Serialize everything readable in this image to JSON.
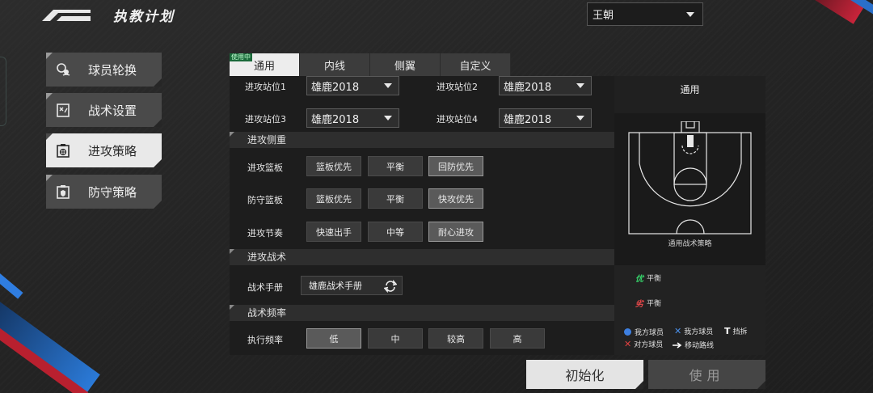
{
  "header": {
    "title": "执教计划",
    "player_select": "王朝"
  },
  "menu": {
    "items": [
      {
        "label": "球员轮换",
        "icon": "player-swap-icon"
      },
      {
        "label": "战术设置",
        "icon": "tactics-board-icon"
      },
      {
        "label": "进攻策略",
        "icon": "offense-strategy-icon",
        "active": true
      },
      {
        "label": "防守策略",
        "icon": "defense-strategy-icon"
      }
    ]
  },
  "tabs": {
    "in_use_badge": "使用中",
    "items": [
      "通用",
      "内线",
      "侧翼",
      "自定义"
    ],
    "active": "通用"
  },
  "positions": {
    "pos1_label": "进攻站位1",
    "pos1_value": "雄鹿2018",
    "pos2_label": "进攻站位2",
    "pos2_value": "雄鹿2018",
    "pos3_label": "进攻站位3",
    "pos3_value": "雄鹿2018",
    "pos4_label": "进攻站位4",
    "pos4_value": "雄鹿2018"
  },
  "offense_focus": {
    "section_title": "进攻侧重",
    "rows": [
      {
        "label": "进攻篮板",
        "options": [
          "篮板优先",
          "平衡",
          "回防优先"
        ],
        "selected": "回防优先"
      },
      {
        "label": "防守篮板",
        "options": [
          "篮板优先",
          "平衡",
          "快攻优先"
        ],
        "selected": "快攻优先"
      },
      {
        "label": "进攻节奏",
        "options": [
          "快速出手",
          "中等",
          "耐心进攻"
        ],
        "selected": "耐心进攻"
      }
    ]
  },
  "offense_tactics": {
    "section_title": "进攻战术",
    "manual_label": "战术手册",
    "manual_value": "雄鹿战术手册"
  },
  "tactic_frequency": {
    "section_title": "战术频率",
    "label": "执行频率",
    "options": [
      "低",
      "中",
      "较高",
      "高"
    ],
    "selected": "低"
  },
  "preview": {
    "title": "通用",
    "caption": "通用战术策略",
    "strength_badge": "优",
    "strength_value": "平衡",
    "weakness_badge": "劣",
    "weakness_value": "平衡",
    "legend": {
      "our_player_dot": "我方球员",
      "our_player_x": "我方球员",
      "screen": "挡拆",
      "opponent": "对方球员",
      "move_route": "移动路线"
    }
  },
  "footer": {
    "reset_label": "初始化",
    "use_label": "使用"
  },
  "colors": {
    "accent_green": "#36d36a",
    "accent_red": "#e8484a",
    "accent_blue": "#3d7fe0"
  }
}
